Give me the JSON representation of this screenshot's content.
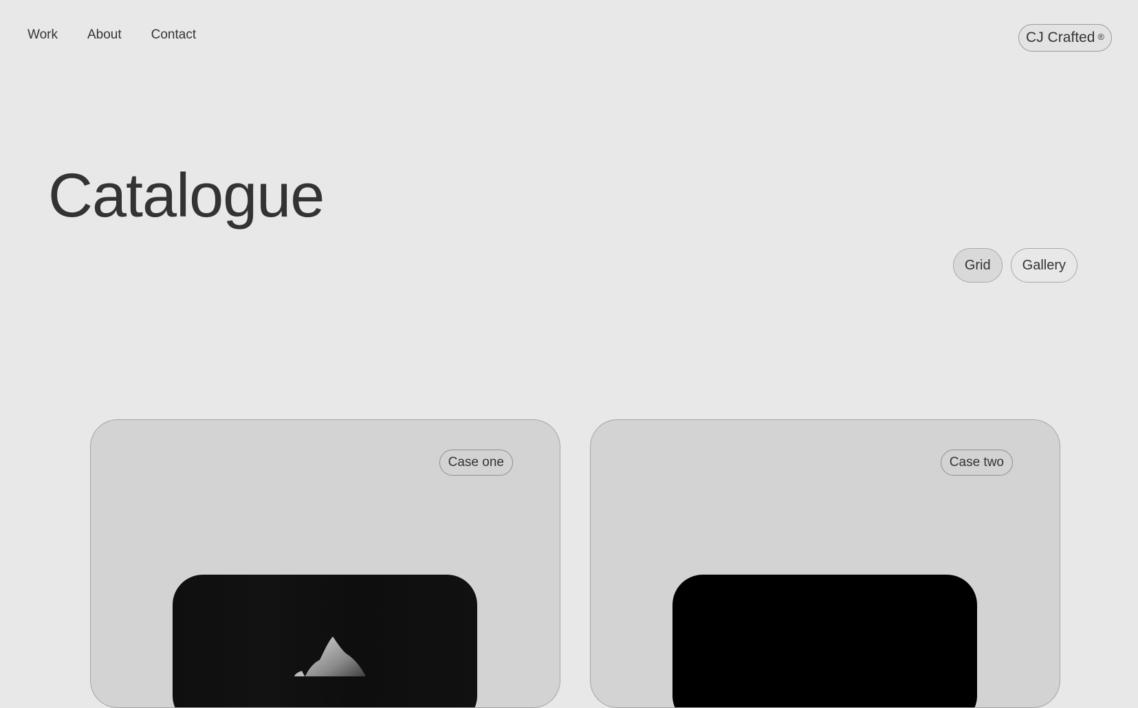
{
  "nav": {
    "items": [
      {
        "label": "Work"
      },
      {
        "label": "About"
      },
      {
        "label": "Contact"
      }
    ]
  },
  "brand": {
    "label": "CJ Crafted",
    "mark": "®"
  },
  "page": {
    "title": "Catalogue"
  },
  "view_toggle": {
    "options": [
      {
        "label": "Grid",
        "active": true
      },
      {
        "label": "Gallery",
        "active": false
      }
    ]
  },
  "cards": [
    {
      "label": "Case one",
      "media": "abstract-sculpture-image"
    },
    {
      "label": "Case two",
      "media": "black-image"
    }
  ],
  "colors": {
    "background": "#e8e8e8",
    "text": "#333333",
    "card": "#d3d3d3",
    "media_dark": "#000000"
  }
}
